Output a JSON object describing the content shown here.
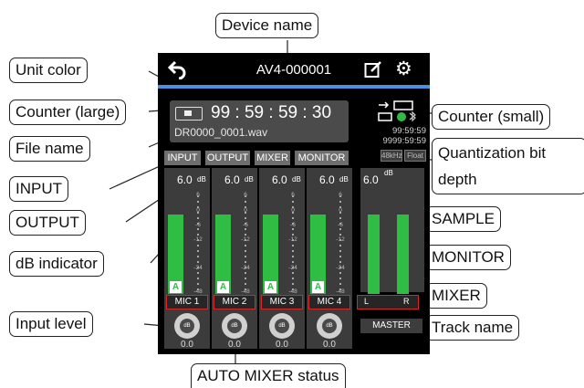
{
  "callouts": {
    "device_name": "Device name",
    "unit_color": "Unit color",
    "counter_large": "Counter (large)",
    "file_name": "File name",
    "input": "INPUT",
    "output": "OUTPUT",
    "db_indicator": "dB indicator",
    "input_level": "Input level",
    "auto_mixer_status": "AUTO MIXER status",
    "counter_small": "Counter (small)",
    "quantization_bit_depth": "Quantization bit depth",
    "sample": "SAMPLE",
    "monitor": "MONITOR",
    "mixer": "MIXER",
    "track_name": "Track name"
  },
  "screen": {
    "device_name": "AV4-000001",
    "unit_color": "#4a8fe0",
    "icons": [
      "back-arrow-icon",
      "edit-icon",
      "gear-icon",
      "usb-icon",
      "battery-icon",
      "sd-card-icon",
      "status-led-icon",
      "bluetooth-icon"
    ],
    "counter_large": "99 : 59 : 59 : 30",
    "file_name": "DR0000_0001.wav",
    "counter_small": [
      "99:59:59",
      "9999:59:59"
    ],
    "sample_rate": "48kHz",
    "bit_depth": "Float",
    "tabs": [
      "INPUT",
      "OUTPUT",
      "MIXER",
      "MONITOR"
    ],
    "channels": [
      {
        "db": "6.0",
        "track": "MIC 1",
        "level": "0.0",
        "auto_mixer": "A",
        "meter": 0.78
      },
      {
        "db": "6.0",
        "track": "MIC 2",
        "level": "0.0",
        "auto_mixer": "A",
        "meter": 0.78
      },
      {
        "db": "6.0",
        "track": "MIC 3",
        "level": "0.0",
        "auto_mixer": "A",
        "meter": 0.78
      },
      {
        "db": "6.0",
        "track": "MIC 4",
        "level": "0.0",
        "auto_mixer": "A",
        "meter": 0.78
      }
    ],
    "db_unit": "dB",
    "scale": [
      "6",
      "0",
      "-6",
      "-12",
      "-24",
      "-48"
    ],
    "knob_label": "dB",
    "master": {
      "db": "6.0",
      "left": "L",
      "right": "R",
      "label": "MASTER"
    },
    "meter_color": "#2fbd44",
    "track_border_color": "#d8262a"
  }
}
